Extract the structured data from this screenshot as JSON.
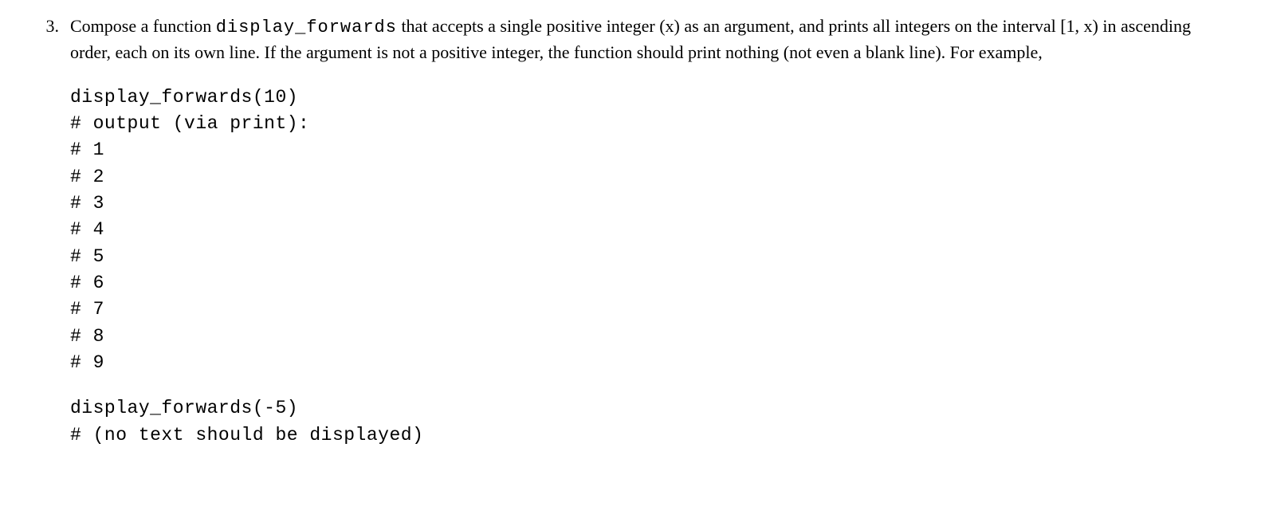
{
  "problem": {
    "number": "3.",
    "prose_parts": {
      "p1": "Compose a function ",
      "fn_name": "display_forwards",
      "p2": " that accepts a single positive integer (x) as an argument, and prints all integers on the interval ",
      "interval": "[1, x)",
      "p3": " in ascending order, each on its own line. If the argument is not a positive integer, the function should print nothing (not even a blank line). For example,"
    },
    "code_example_1": "display_forwards(10)\n# output (via print):\n# 1\n# 2\n# 3\n# 4\n# 5\n# 6\n# 7\n# 8\n# 9",
    "code_example_2": "display_forwards(-5)\n# (no text should be displayed)"
  }
}
